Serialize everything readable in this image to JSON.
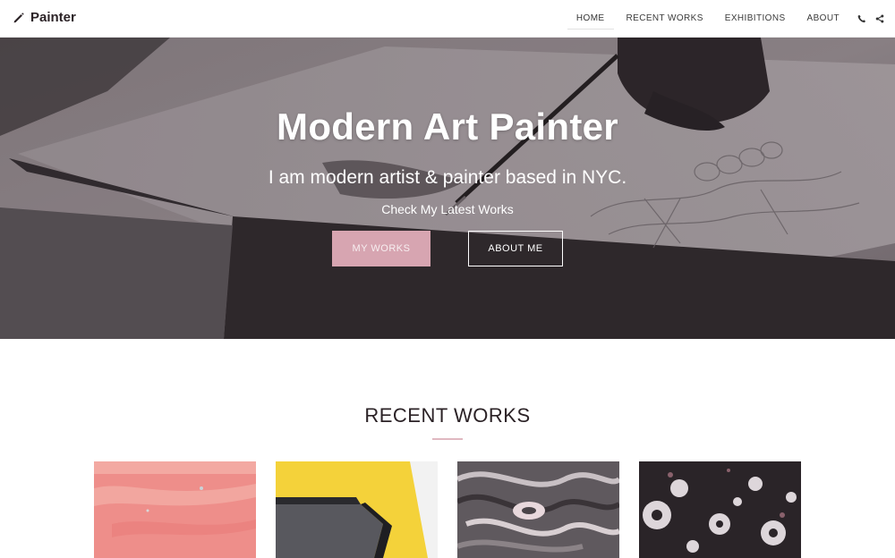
{
  "header": {
    "brand": {
      "name": "Painter",
      "icon": "pencil-icon"
    },
    "nav": [
      {
        "label": "HOME",
        "active": true
      },
      {
        "label": "RECENT WORKS",
        "active": false
      },
      {
        "label": "EXHIBITIONS",
        "active": false
      },
      {
        "label": "ABOUT",
        "active": false
      }
    ],
    "icons": [
      "phone-icon",
      "share-icon"
    ]
  },
  "hero": {
    "title": "Modern Art Painter",
    "subtitle": "I am modern artist & painter based in NYC.",
    "tagline": "Check My Latest Works",
    "buttons": {
      "primary": "MY WORKS",
      "secondary": "ABOUT ME"
    }
  },
  "recent_works": {
    "title": "RECENT WORKS",
    "items": [
      {
        "label": "pink-abstract"
      },
      {
        "label": "yellow-geometric"
      },
      {
        "label": "marble-swirl"
      },
      {
        "label": "ink-splatter"
      }
    ]
  },
  "colors": {
    "accent": "#d7a5b1",
    "text": "#2b2226",
    "hero_overlay": "#3a3035"
  }
}
